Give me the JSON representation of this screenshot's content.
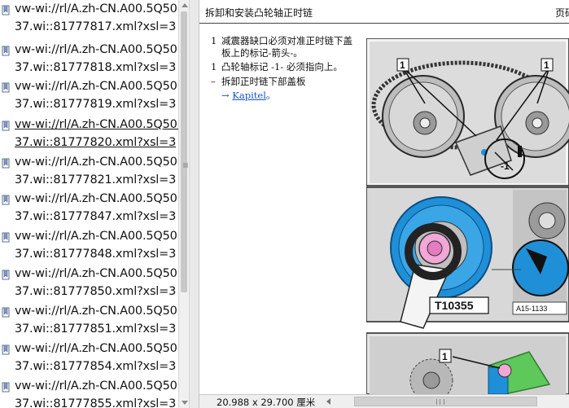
{
  "nav": {
    "items": [
      {
        "line1": "vw-wi://rl/A.zh-CN.A00.5Q50.",
        "line2": "37.wi::81777817.xml?xsl=3"
      },
      {
        "line1": "vw-wi://rl/A.zh-CN.A00.5Q50.",
        "line2": "37.wi::81777818.xml?xsl=3"
      },
      {
        "line1": "vw-wi://rl/A.zh-CN.A00.5Q50.",
        "line2": "37.wi::81777819.xml?xsl=3"
      },
      {
        "line1": "vw-wi://rl/A.zh-CN.A00.5Q50.",
        "line2": "37.wi::81777820.xml?xsl=3",
        "selected": true
      },
      {
        "line1": "vw-wi://rl/A.zh-CN.A00.5Q50.",
        "line2": "37.wi::81777821.xml?xsl=3"
      },
      {
        "line1": "vw-wi://rl/A.zh-CN.A00.5Q50.",
        "line2": "37.wi::81777847.xml?xsl=3"
      },
      {
        "line1": "vw-wi://rl/A.zh-CN.A00.5Q50.",
        "line2": "37.wi::81777848.xml?xsl=3"
      },
      {
        "line1": "vw-wi://rl/A.zh-CN.A00.5Q50.",
        "line2": "37.wi::81777850.xml?xsl=3"
      },
      {
        "line1": "vw-wi://rl/A.zh-CN.A00.5Q50.",
        "line2": "37.wi::81777851.xml?xsl=3"
      },
      {
        "line1": "vw-wi://rl/A.zh-CN.A00.5Q50.",
        "line2": "37.wi::81777854.xml?xsl=3"
      },
      {
        "line1": "vw-wi://rl/A.zh-CN.A00.5Q50.",
        "line2": "37.wi::81777855.xml?xsl=3"
      }
    ]
  },
  "doc": {
    "title": "拆卸和安装凸轮轴正时链",
    "page_label": "页码",
    "steps": [
      {
        "num": "1",
        "line1": "减震器缺口必须对准正时链下盖",
        "line2": "板上的标记-箭头-。"
      },
      {
        "num": "1",
        "line1": "凸轮轴标记 -1- 必须指向上。"
      },
      {
        "num": "–",
        "line1": "拆卸正时链下部盖板"
      }
    ],
    "link_arrow": "→",
    "link_text": "Kapitel",
    "link_suffix": "。",
    "figures": {
      "fig1_callout_left": "1",
      "fig1_callout_right": "1",
      "fig1_callout_bottom": "-1",
      "fig2_tool_label": "T10355",
      "fig2_ref": "A15-1133",
      "fig3_callout": "1"
    }
  },
  "status": {
    "page_size": "20.988 x 29.700 厘米"
  },
  "icons": {
    "nav_item": "bookmark-icon"
  },
  "colors": {
    "link": "#1a55c9",
    "highlight_blue": "#1f8fd8",
    "highlight_pink": "#f2a7d6",
    "highlight_green": "#5ec85a"
  }
}
